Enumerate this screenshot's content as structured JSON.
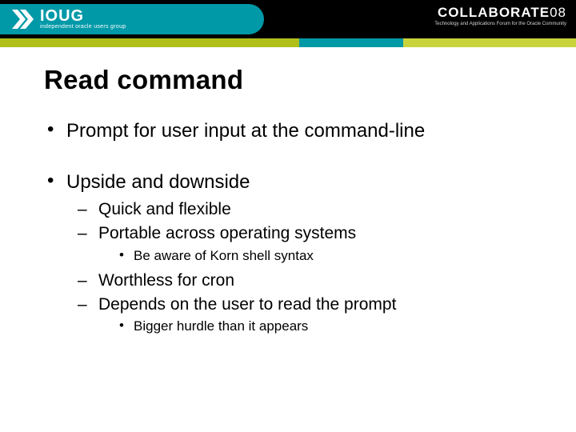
{
  "header": {
    "brand": "IOUG",
    "brand_sub": "independent oracle users group",
    "conference": "COLLABORATE",
    "conference_year": "08",
    "tagline": "Technology and Applications Forum for the Oracle Community"
  },
  "title": "Read command",
  "bullets_lvl1": {
    "0": "Prompt for user input at the command-line",
    "1": "Upside and downside"
  },
  "bullets_lvl2": {
    "0": "Quick and flexible",
    "1": "Portable across operating systems",
    "2": "Worthless for cron",
    "3": "Depends on the user to read the prompt"
  },
  "bullets_lvl3": {
    "0": "Be aware of Korn shell syntax",
    "1": "Bigger hurdle than it appears"
  }
}
